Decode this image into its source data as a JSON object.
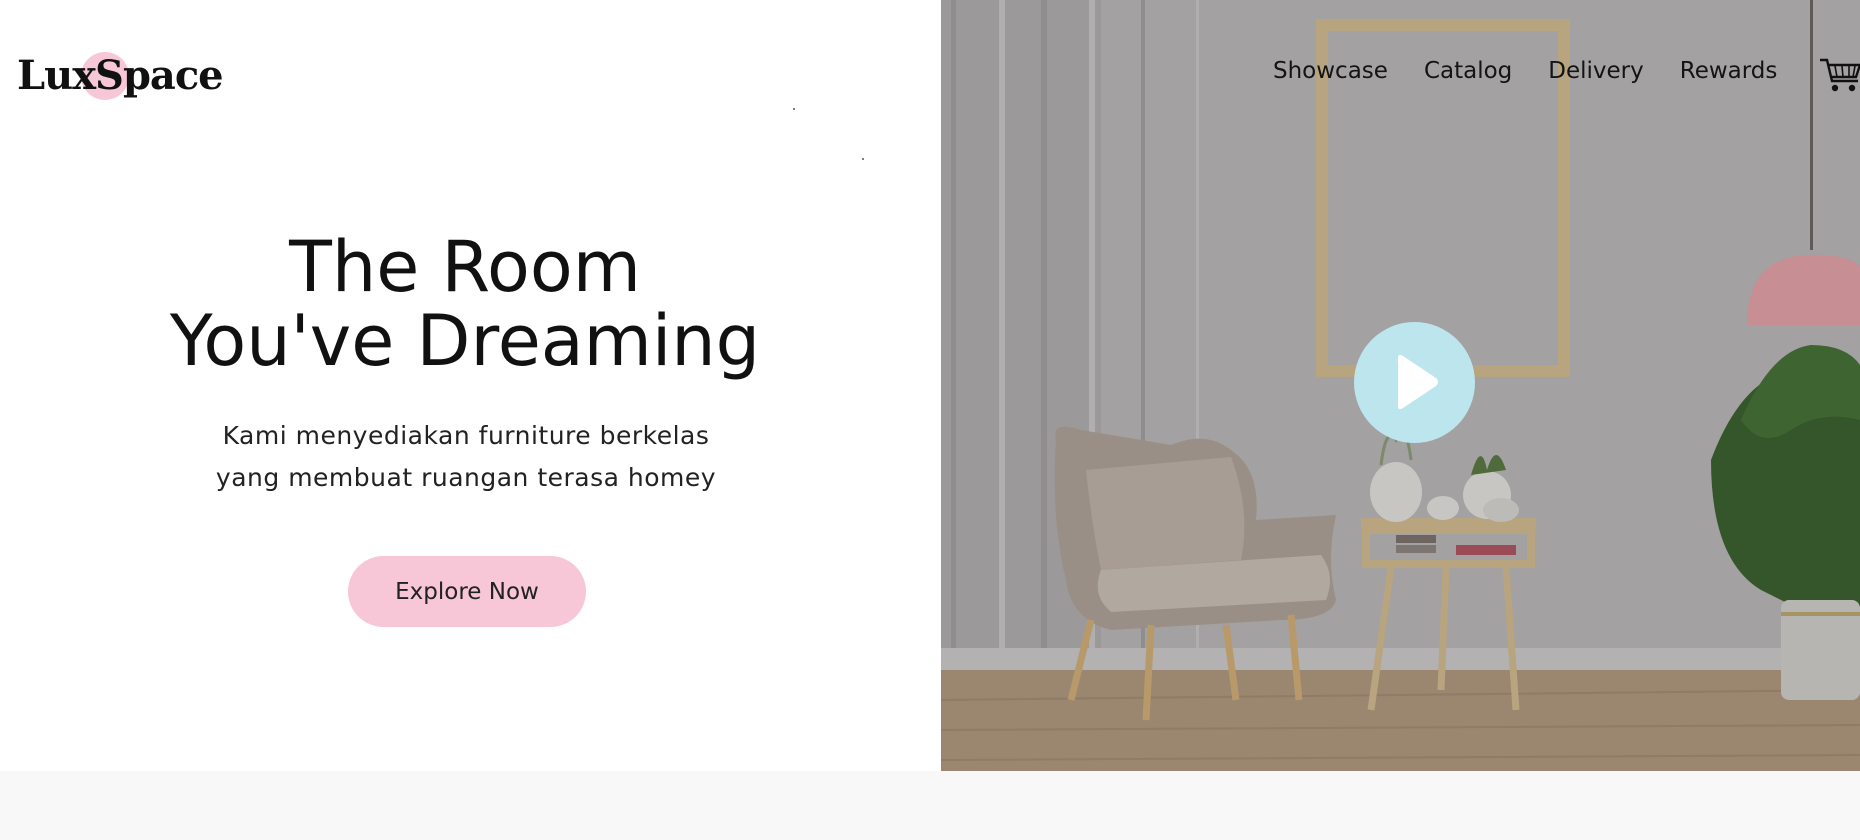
{
  "brand": {
    "name": "LuxSpace",
    "accent_color": "#f7c7d7"
  },
  "nav": {
    "items": [
      {
        "label": "Showcase"
      },
      {
        "label": "Catalog"
      },
      {
        "label": "Delivery"
      },
      {
        "label": "Rewards"
      }
    ],
    "cart_icon": "shopping-cart-icon"
  },
  "hero": {
    "headline_line1": "The Room",
    "headline_line2": "You've Dreaming",
    "subtitle_line1": "Kami menyediakan furniture berkelas",
    "subtitle_line2": "yang membuat ruangan terasa homey",
    "cta_label": "Explore Now",
    "cta_color": "#f7c7d7",
    "play_icon": "play-icon",
    "play_button_color": "#bde5ee"
  }
}
